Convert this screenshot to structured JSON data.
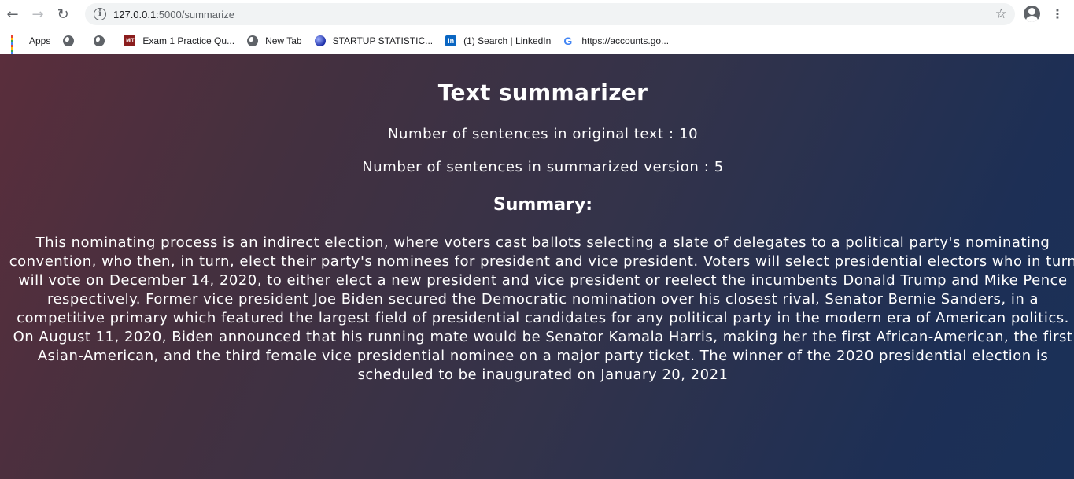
{
  "browser": {
    "url_host": "127.0.0.1",
    "url_path": ":5000/summarize",
    "bookmarks": [
      {
        "label": "Apps",
        "icon": "apps-grid-icon"
      },
      {
        "label": "",
        "icon": "globe-icon"
      },
      {
        "label": "",
        "icon": "globe-icon"
      },
      {
        "label": "Exam 1 Practice Qu...",
        "icon": "mit-icon"
      },
      {
        "label": "New Tab",
        "icon": "globe-icon"
      },
      {
        "label": "STARTUP STATISTIC...",
        "icon": "sphere-icon"
      },
      {
        "label": "(1) Search | LinkedIn",
        "icon": "linkedin-icon"
      },
      {
        "label": "https://accounts.go...",
        "icon": "google-icon"
      }
    ]
  },
  "page": {
    "title": "Text summarizer",
    "original_count_text": "Number of sentences in original text : 10",
    "summary_count_text": "Number of sentences in summarized version : 5",
    "summary_heading": "Summary:",
    "summary_lines": [
      "This nominating process is an indirect election, where voters cast ballots selecting a slate of delegates to a political party's nominating",
      "convention, who then, in turn, elect their party's nominees for president and vice president. Voters will select presidential electors who in turn",
      "will vote on December 14, 2020, to either elect a new president and vice president or reelect the incumbents Donald Trump and Mike Pence",
      "respectively. Former vice president Joe Biden secured the Democratic nomination over his closest rival, Senator Bernie Sanders, in a",
      "competitive primary which featured the largest field of presidential candidates for any political party in the modern era of American politics.",
      "On August 11, 2020, Biden announced that his running mate would be Senator Kamala Harris, making her the first African-American, the first",
      "Asian-American, and the third female vice presidential nominee on a major party ticket. The winner of the 2020 presidential election is",
      "scheduled to be inaugurated on January 20, 2021"
    ]
  },
  "colors": {
    "gradient_start": "#5a2e3c",
    "gradient_end": "#1a3058",
    "text": "#ffffff"
  }
}
